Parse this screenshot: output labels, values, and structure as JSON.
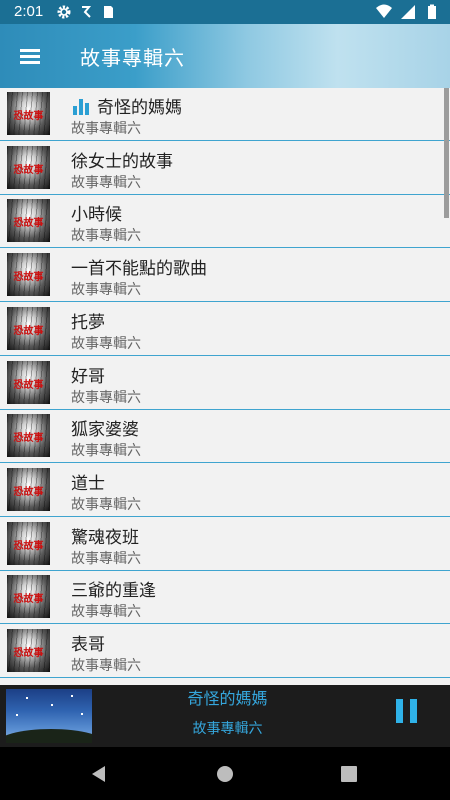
{
  "status": {
    "time": "2:01",
    "left_icons": [
      "gear-icon",
      "sync-icon",
      "sd-card-icon"
    ],
    "right_icons": [
      "wifi-icon",
      "signal-icon",
      "battery-icon"
    ]
  },
  "appbar": {
    "title": "故事專輯六",
    "menu_icon": "menu-icon"
  },
  "list": {
    "items": [
      {
        "title": "奇怪的媽媽",
        "subtitle": "故事專輯六",
        "playing": true,
        "thumb_text": "恐故事"
      },
      {
        "title": "徐女士的故事",
        "subtitle": "故事專輯六",
        "thumb_text": "恐故事"
      },
      {
        "title": "小時候",
        "subtitle": "故事專輯六",
        "thumb_text": "恐故事"
      },
      {
        "title": "一首不能點的歌曲",
        "subtitle": "故事專輯六",
        "thumb_text": "恐故事"
      },
      {
        "title": "托夢",
        "subtitle": "故事專輯六",
        "thumb_text": "恐故事"
      },
      {
        "title": "好哥",
        "subtitle": "故事專輯六",
        "thumb_text": "恐故事"
      },
      {
        "title": "狐家婆婆",
        "subtitle": "故事專輯六",
        "thumb_text": "恐故事"
      },
      {
        "title": "道士",
        "subtitle": "故事專輯六",
        "thumb_text": "恐故事"
      },
      {
        "title": "驚魂夜班",
        "subtitle": "故事專輯六",
        "thumb_text": "恐故事"
      },
      {
        "title": "三爺的重逢",
        "subtitle": "故事專輯六",
        "thumb_text": "恐故事"
      },
      {
        "title": "表哥",
        "subtitle": "故事專輯六",
        "thumb_text": "恐故事"
      }
    ]
  },
  "player": {
    "title": "奇怪的媽媽",
    "subtitle": "故事專輯六",
    "state_icon": "pause-icon"
  },
  "navbar": {
    "icons": [
      "back-icon",
      "home-icon",
      "recents-icon"
    ]
  },
  "colors": {
    "accent": "#35a6dc",
    "divider": "#3fa4cf",
    "statusbar": "#1b6f94"
  }
}
